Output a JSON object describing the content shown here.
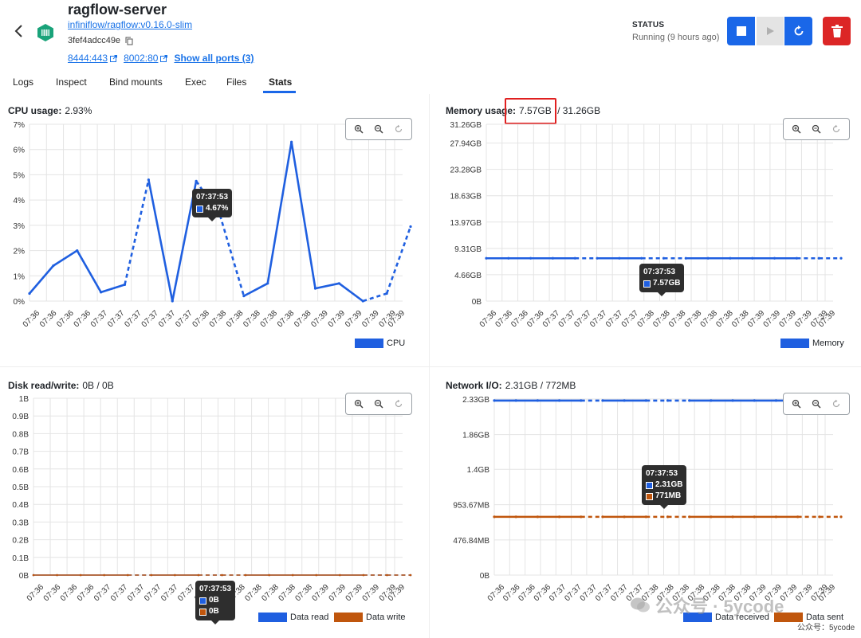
{
  "header": {
    "title": "ragflow-server",
    "image": "infiniflow/ragflow:v0.16.0-slim",
    "container_id": "3fef4adcc49e",
    "ports": [
      "8444:443",
      "8002:80"
    ],
    "show_all_ports": "Show all ports (3)",
    "status_label": "STATUS",
    "status_value": "Running (9 hours ago)"
  },
  "tabs": [
    "Logs",
    "Inspect",
    "Bind mounts",
    "Exec",
    "Files",
    "Stats"
  ],
  "active_tab": "Stats",
  "colors": {
    "accent": "#1a67e8",
    "danger": "#dc2626",
    "series_blue": "#1f5fe0",
    "series_orange": "#c0560d"
  },
  "x_ticks": [
    "07:36",
    "07:36",
    "07:36",
    "07:36",
    "07:37",
    "07:37",
    "07:37",
    "07:37",
    "07:37",
    "07:37",
    "07:38",
    "07:38",
    "07:38",
    "07:38",
    "07:38",
    "07:38",
    "07:38",
    "07:39",
    "07:39",
    "07:39",
    "07:39",
    "07:39",
    "07:39"
  ],
  "panels": {
    "cpu": {
      "label": "CPU usage:",
      "value": "2.93%"
    },
    "memory": {
      "label": "Memory usage:",
      "value": "7.57GB",
      "total": "/  31.26GB"
    },
    "disk": {
      "label": "Disk read/write:",
      "value": "0B / 0B"
    },
    "network": {
      "label": "Network I/O:",
      "value": "2.31GB / 772MB"
    }
  },
  "tooltips": {
    "cpu": {
      "time": "07:37:53",
      "v1": "4.67%"
    },
    "memory": {
      "time": "07:37:53",
      "v1": "7.57GB"
    },
    "disk": {
      "time": "07:37:53",
      "v1": "0B",
      "v2": "0B"
    },
    "network": {
      "time": "07:37:53",
      "v1": "2.31GB",
      "v2": "771MB"
    }
  },
  "watermark": {
    "text": "公众号 · 5ycode",
    "sub": "公众号：5ycode"
  },
  "chart_data": [
    {
      "type": "line",
      "title": "CPU usage",
      "y_ticks": [
        "0%",
        "1%",
        "2%",
        "3%",
        "4%",
        "5%",
        "6%",
        "7%"
      ],
      "ylim": [
        0,
        7
      ],
      "series": [
        {
          "name": "CPU",
          "values": [
            0.3,
            1.4,
            2.0,
            0.35,
            0.65,
            4.8,
            0.0,
            4.75,
            3.4,
            0.2,
            0.7,
            6.3,
            0.5,
            0.7,
            0.0,
            0.3,
            2.95
          ]
        }
      ],
      "legend": "bottom-right"
    },
    {
      "type": "line",
      "title": "Memory usage",
      "y_ticks": [
        "0B",
        "4.66GB",
        "9.31GB",
        "13.97GB",
        "18.63GB",
        "23.28GB",
        "27.94GB",
        "31.26GB"
      ],
      "y_tick_values": [
        0,
        4.66,
        9.31,
        13.97,
        18.63,
        23.28,
        27.94,
        31.26
      ],
      "ylim": [
        0,
        31.26
      ],
      "series": [
        {
          "name": "Memory",
          "values": [
            7.57,
            7.57,
            7.57,
            7.57,
            7.57,
            7.57,
            7.57,
            7.57,
            7.57,
            7.57,
            7.57,
            7.57,
            7.57,
            7.57,
            7.57,
            7.57,
            7.57
          ]
        }
      ],
      "legend": "bottom-right"
    },
    {
      "type": "line",
      "title": "Disk read/write",
      "y_ticks": [
        "0B",
        "0.1B",
        "0.2B",
        "0.3B",
        "0.4B",
        "0.5B",
        "0.6B",
        "0.7B",
        "0.8B",
        "0.9B",
        "1B"
      ],
      "ylim": [
        0,
        1
      ],
      "series": [
        {
          "name": "Data read",
          "values": [
            0,
            0,
            0,
            0,
            0,
            0,
            0,
            0,
            0,
            0,
            0,
            0,
            0,
            0,
            0,
            0,
            0
          ]
        },
        {
          "name": "Data write",
          "values": [
            0,
            0,
            0,
            0,
            0,
            0,
            0,
            0,
            0,
            0,
            0,
            0,
            0,
            0,
            0,
            0,
            0
          ]
        }
      ],
      "legend": "bottom-right"
    },
    {
      "type": "line",
      "title": "Network I/O",
      "y_ticks": [
        "0B",
        "476.84MB",
        "953.67MB",
        "1.4GB",
        "1.86GB",
        "2.33GB"
      ],
      "y_tick_values": [
        0,
        0.4657,
        0.9313,
        1.4,
        1.86,
        2.33
      ],
      "ylim": [
        0,
        2.33
      ],
      "series": [
        {
          "name": "Data received",
          "values": [
            2.31,
            2.31,
            2.31,
            2.31,
            2.31,
            2.31,
            2.31,
            2.31,
            2.31,
            2.31,
            2.31,
            2.31,
            2.31,
            2.31,
            2.31,
            2.31,
            2.31
          ]
        },
        {
          "name": "Data sent",
          "values": [
            0.771,
            0.771,
            0.771,
            0.771,
            0.771,
            0.771,
            0.771,
            0.771,
            0.771,
            0.771,
            0.771,
            0.771,
            0.771,
            0.771,
            0.771,
            0.771,
            0.771
          ]
        }
      ],
      "legend": "bottom-right"
    }
  ]
}
